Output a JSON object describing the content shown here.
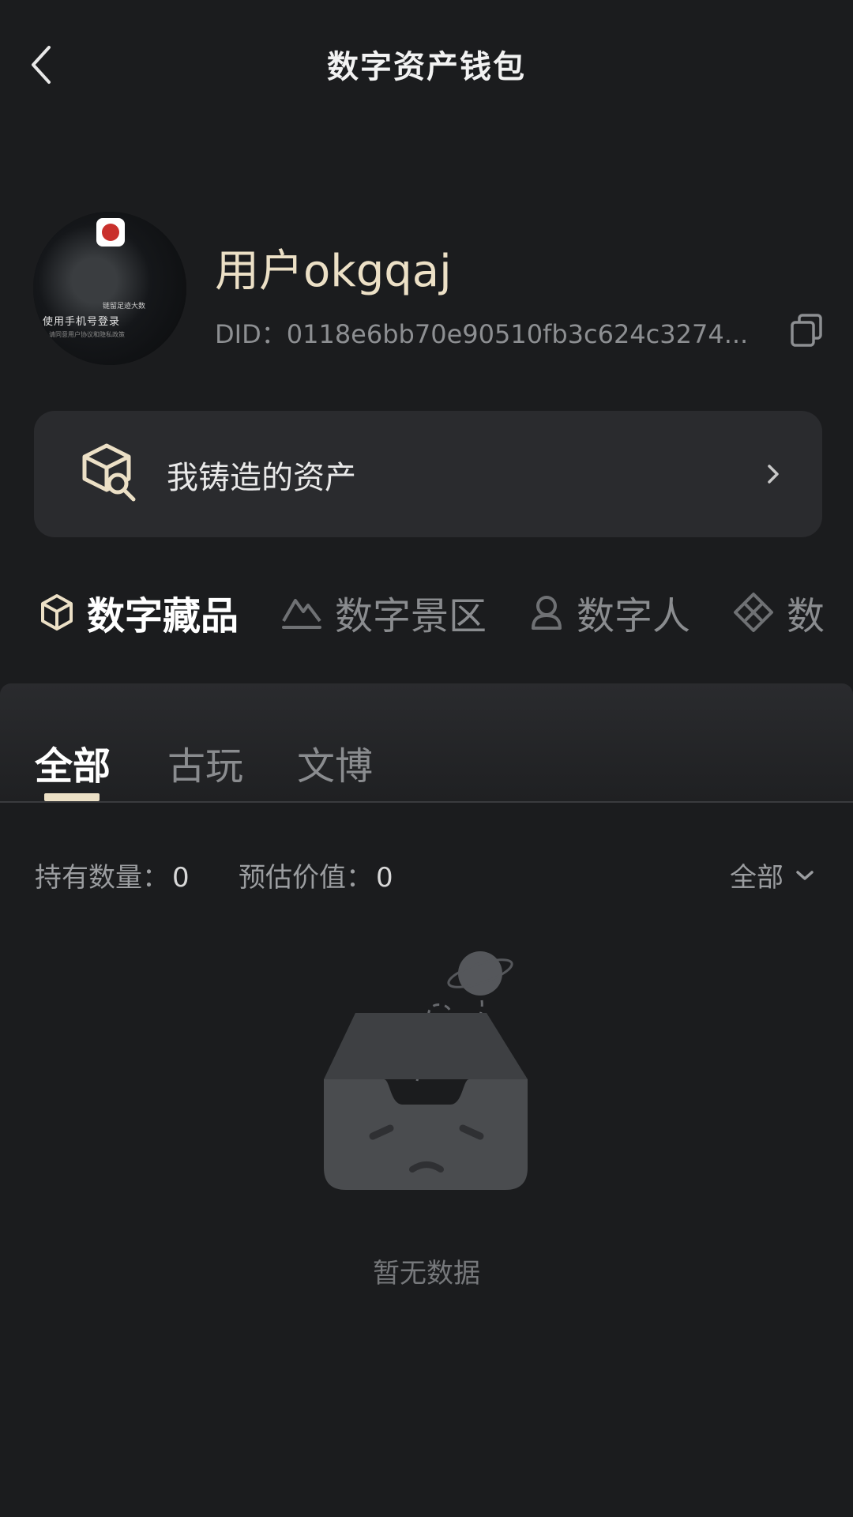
{
  "header": {
    "title": "数字资产钱包",
    "back_icon": "back-arrow-icon"
  },
  "profile": {
    "username": "用户okgqaj",
    "did_label": "DID：",
    "did_value": "0118e6bb70e90510fb3c624c3274...",
    "avatar_caption_small": "链留足迹大数",
    "avatar_caption": "使用手机号登录",
    "avatar_caption_tiny": "请同意用户协议和隐私政策"
  },
  "minted_card": {
    "label": "我铸造的资产",
    "icon": "mint-box-icon",
    "chevron": "chevron-right-icon"
  },
  "categories": [
    {
      "label": "数字藏品",
      "icon": "cube-icon",
      "active": true
    },
    {
      "label": "数字景区",
      "icon": "mountain-icon",
      "active": false
    },
    {
      "label": "数字人",
      "icon": "person-icon",
      "active": false
    },
    {
      "label": "数",
      "icon": "diamond-grid-icon",
      "active": false
    }
  ],
  "subtabs": [
    {
      "label": "全部",
      "active": true
    },
    {
      "label": "古玩",
      "active": false
    },
    {
      "label": "文博",
      "active": false
    }
  ],
  "stats": {
    "holding_label": "持有数量：",
    "holding_value": "0",
    "estimate_label": "预估价值：",
    "estimate_value": "0",
    "filter_label": "全部"
  },
  "empty_state": {
    "text": "暂无数据",
    "icon": "empty-box-planet-icon"
  },
  "colors": {
    "background": "#1b1c1e",
    "accent_gold": "#ece0c6",
    "card": "#2a2b2e",
    "muted": "#8a8c8f"
  }
}
